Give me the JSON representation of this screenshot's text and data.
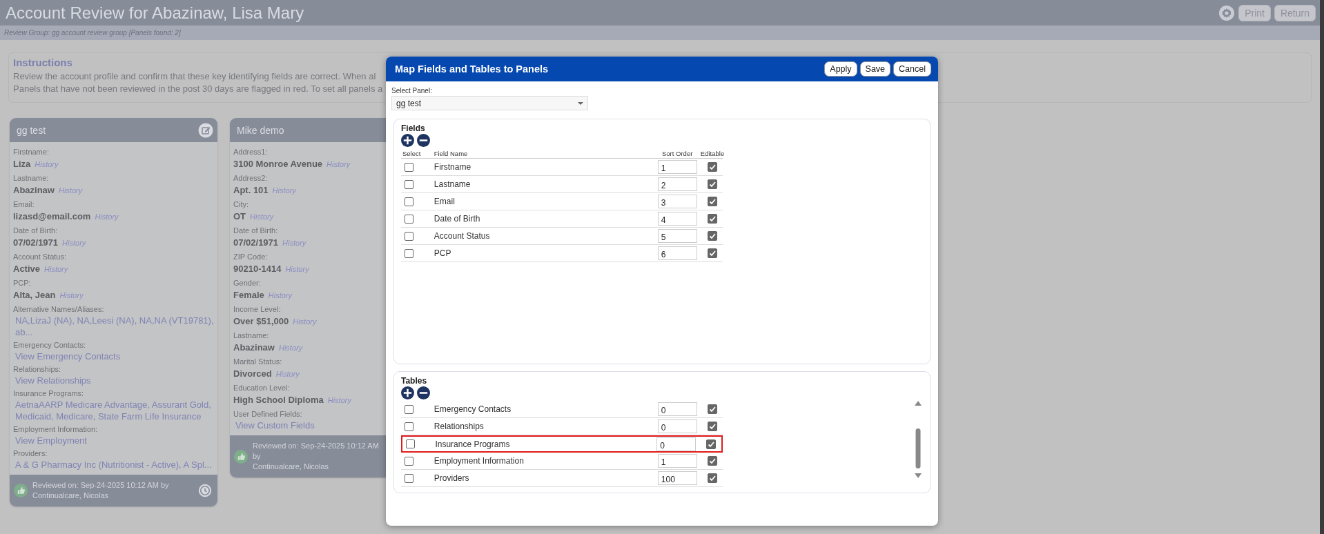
{
  "header": {
    "title": "Account Review for Abazinaw, Lisa Mary",
    "buttons": [
      "Print",
      "Return"
    ]
  },
  "subheader": "Review Group: gg account review group [Panels found: 2]",
  "instructions": {
    "title": "Instructions",
    "lines": [
      "Review the account profile and confirm that these key identifying fields are correct. When al",
      "Panels that have not been reviewed in the post 30 days are flagged in red. To set all panels a"
    ]
  },
  "panels": [
    {
      "title": "gg test",
      "editable": true,
      "fields": [
        {
          "label": "Firstname:",
          "kind": "value",
          "value": "Liza",
          "history": "History"
        },
        {
          "label": "Lastname:",
          "kind": "value",
          "value": "Abazinaw",
          "history": "History"
        },
        {
          "label": "Email:",
          "kind": "value",
          "value": "lizasd@email.com",
          "history": "History"
        },
        {
          "label": "Date of Birth:",
          "kind": "value",
          "value": "07/02/1971",
          "history": "History"
        },
        {
          "label": "Account Status:",
          "kind": "value",
          "value": "Active",
          "history": "History"
        },
        {
          "label": "PCP:",
          "kind": "value",
          "value": "Alta, Jean",
          "history": "History"
        },
        {
          "label": "Alternative Names/Aliases:",
          "kind": "link",
          "value": "NA,LizaJ (NA), NA,Leesi (NA), NA,NA (VT19781), ab..."
        },
        {
          "label": "Emergency Contacts:",
          "kind": "link",
          "value": "View Emergency Contacts"
        },
        {
          "label": "Relationships:",
          "kind": "link",
          "value": "View Relationships"
        },
        {
          "label": "Insurance Programs:",
          "kind": "link",
          "value": "AetnaAARP Medicare Advantage, Assurant Gold, Medicaid, Medicare, State Farm Life Insurance"
        },
        {
          "label": "Employment Information:",
          "kind": "link",
          "value": "View Employment"
        },
        {
          "label": "Providers:",
          "kind": "link",
          "value": "A & G Pharmacy Inc (Nutritionist - Active), A Spl..."
        }
      ],
      "review": {
        "lines": [
          "Reviewed on: Sep-24-2025 10:12 AM by",
          "Continualcare, Nicolas"
        ],
        "history": true
      }
    },
    {
      "title": "Mike demo",
      "editable": false,
      "fields": [
        {
          "label": "Address1:",
          "kind": "value",
          "value": "3100 Monroe Avenue",
          "history": "History"
        },
        {
          "label": "Address2:",
          "kind": "value",
          "value": "Apt. 101",
          "history": "History"
        },
        {
          "label": "City:",
          "kind": "value",
          "value": "OT",
          "history": "History"
        },
        {
          "label": "Date of Birth:",
          "kind": "value",
          "value": "07/02/1971",
          "history": "History"
        },
        {
          "label": "ZIP Code:",
          "kind": "value",
          "value": "90210-1414",
          "history": "History"
        },
        {
          "label": "Gender:",
          "kind": "value",
          "value": "Female",
          "history": "History"
        },
        {
          "label": "Income Level:",
          "kind": "value",
          "value": "Over $51,000",
          "history": "History"
        },
        {
          "label": "Lastname:",
          "kind": "value",
          "value": "Abazinaw",
          "history": "History"
        },
        {
          "label": "Marital Status:",
          "kind": "value",
          "value": "Divorced",
          "history": "History"
        },
        {
          "label": "Education Level:",
          "kind": "value",
          "value": "High School Diploma",
          "history": "History"
        },
        {
          "label": "User Defined Fields:",
          "kind": "link",
          "value": "View Custom Fields"
        }
      ],
      "review": {
        "lines": [
          "Reviewed on: Sep-24-2025 10:12 AM by",
          "Continualcare, Nicolas"
        ],
        "history": false
      }
    }
  ],
  "modal": {
    "title": "Map Fields and Tables to Panels",
    "buttons": [
      "Apply",
      "Save",
      "Cancel"
    ],
    "select_panel": {
      "label": "Select Panel:",
      "value": "gg test"
    },
    "sections": [
      {
        "title": "Fields",
        "columns": [
          "Select",
          "Field Name",
          "Sort Order",
          "Editable"
        ],
        "scrollable": false,
        "rows": [
          {
            "name": "Firstname",
            "selected": false,
            "sort_order": "1",
            "editable": true,
            "highlighted": false
          },
          {
            "name": "Lastname",
            "selected": false,
            "sort_order": "2",
            "editable": true,
            "highlighted": false
          },
          {
            "name": "Email",
            "selected": false,
            "sort_order": "3",
            "editable": true,
            "highlighted": false
          },
          {
            "name": "Date of Birth",
            "selected": false,
            "sort_order": "4",
            "editable": true,
            "highlighted": false
          },
          {
            "name": "Account Status",
            "selected": false,
            "sort_order": "5",
            "editable": true,
            "highlighted": false
          },
          {
            "name": "PCP",
            "selected": false,
            "sort_order": "6",
            "editable": true,
            "highlighted": false
          }
        ]
      },
      {
        "title": "Tables",
        "scrollable": true,
        "rows": [
          {
            "name": "Emergency Contacts",
            "selected": false,
            "sort_order": "0",
            "editable": true,
            "highlighted": false
          },
          {
            "name": "Relationships",
            "selected": false,
            "sort_order": "0",
            "editable": true,
            "highlighted": false
          },
          {
            "name": "Insurance Programs",
            "selected": false,
            "sort_order": "0",
            "editable": true,
            "highlighted": true
          },
          {
            "name": "Employment Information",
            "selected": false,
            "sort_order": "1",
            "editable": true,
            "highlighted": false
          },
          {
            "name": "Providers",
            "selected": false,
            "sort_order": "100",
            "editable": true,
            "highlighted": false
          }
        ]
      }
    ]
  }
}
